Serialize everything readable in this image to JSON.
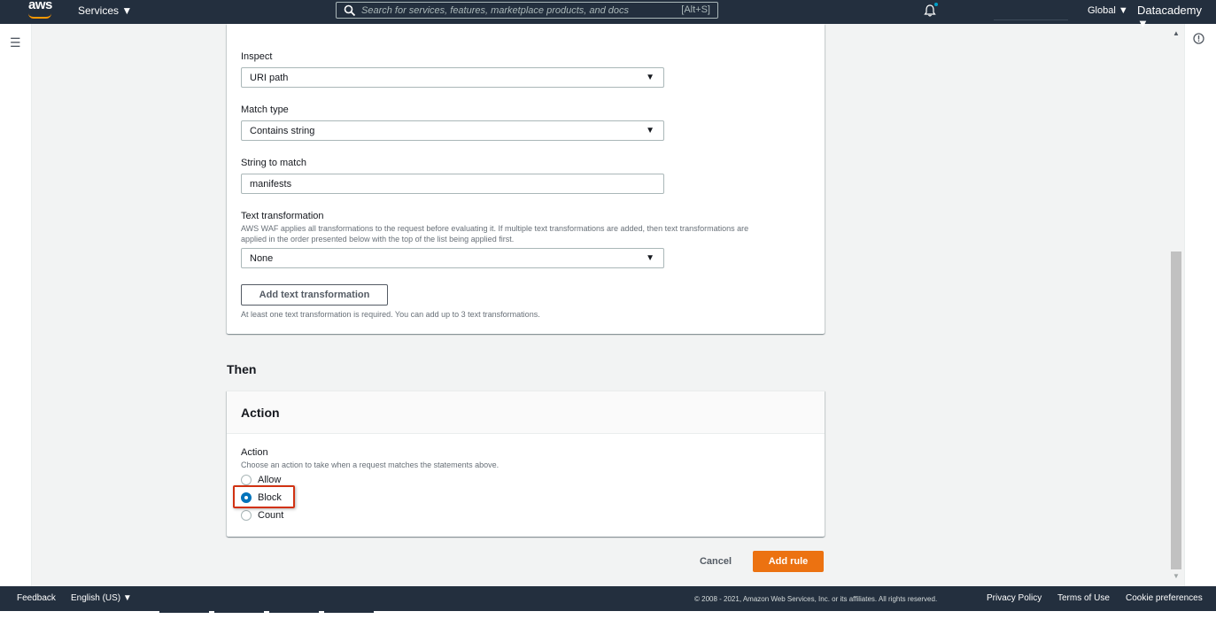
{
  "topnav": {
    "logo": "aws",
    "services_label": "Services ▼",
    "search_placeholder": "Search for services, features, marketplace products, and docs",
    "search_shortcut": "[Alt+S]",
    "region_label": "Global ▼",
    "account_label": "Datacademy ▼",
    "icons": [
      "search-icon",
      "bell-icon"
    ]
  },
  "sidebar": {
    "menu_icon": "☰"
  },
  "statement": {
    "inspect": {
      "label": "Inspect",
      "value": "URI path"
    },
    "match_type": {
      "label": "Match type",
      "value": "Contains string"
    },
    "string_to_match": {
      "label": "String to match",
      "value": "manifests"
    },
    "text_transformation": {
      "label": "Text transformation",
      "description_line1": "AWS WAF applies all transformations to the request before evaluating it. If multiple text transformations are added, then text transformations are",
      "description_line2": "applied in the order presented below with the top of the list being applied first.",
      "value": "None",
      "add_button": "Add text transformation",
      "hint": "At least one text transformation is required. You can add up to 3 text transformations."
    }
  },
  "then": {
    "title": "Then",
    "card_title": "Action",
    "field_label": "Action",
    "description": "Choose an action to take when a request matches the statements above.",
    "options": [
      {
        "label": "Allow",
        "checked": false
      },
      {
        "label": "Block",
        "checked": true
      },
      {
        "label": "Count",
        "checked": false
      }
    ]
  },
  "actions": {
    "cancel": "Cancel",
    "add_rule": "Add rule"
  },
  "footer": {
    "feedback": "Feedback",
    "language": "English (US) ▼",
    "copyright": "© 2008 - 2021, Amazon Web Services, Inc. or its affiliates. All rights reserved.",
    "privacy": "Privacy Policy",
    "terms": "Terms of Use",
    "cookies": "Cookie preferences"
  },
  "colors": {
    "nav": "#232f3e",
    "primary": "#ec7211",
    "radio_checked": "#0073bb",
    "highlight": "#d13212"
  }
}
